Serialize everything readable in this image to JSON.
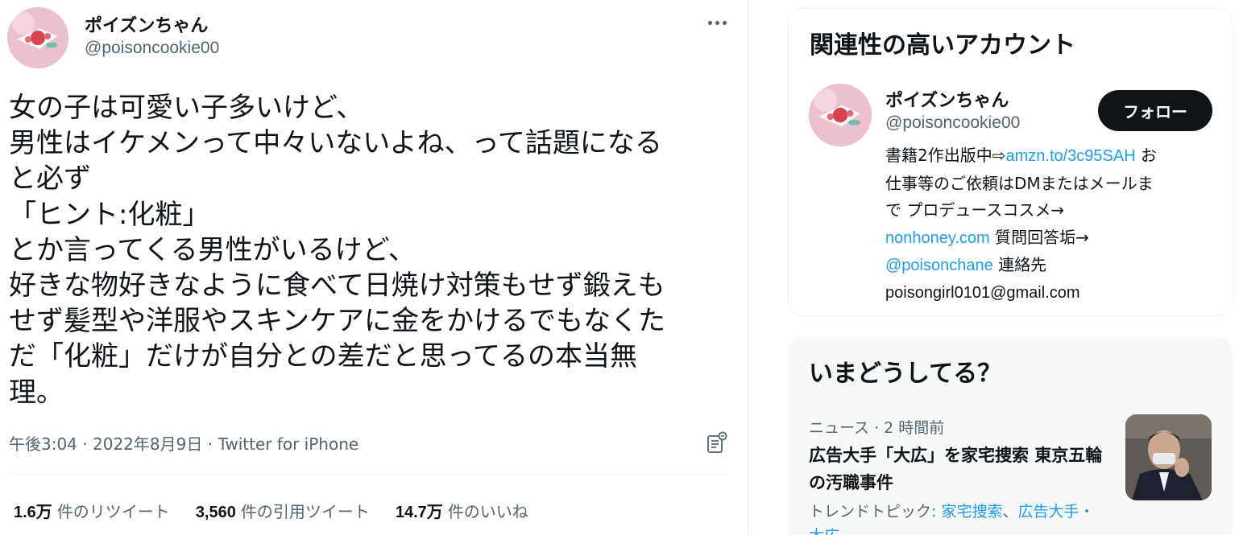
{
  "tweet": {
    "author_name": "ポイズンちゃん",
    "author_handle": "@poisoncookie00",
    "text_lines": [
      "女の子は可愛い子多いけど、",
      "男性はイケメンって中々いないよね、って話題になる",
      "と必ず",
      "「ヒント:化粧」",
      "とか言ってくる男性がいるけど、",
      "好きな物好きなように食べて日焼け対策もせず鍛えも",
      "せず髪型や洋服やスキンケアに金をかけるでもなくた",
      "だ「化粧」だけが自分との差だと思ってるの本当無",
      "理。"
    ],
    "time": "午後3:04",
    "separator": "·",
    "date": "2022年8月9日",
    "source": "Twitter for iPhone",
    "stats": {
      "retweets_count": "1.6万",
      "retweets_label": "件のリツイート",
      "quotes_count": "3,560",
      "quotes_label": "件の引用ツイート",
      "likes_count": "14.7万",
      "likes_label": "件のいいね"
    }
  },
  "sidebar": {
    "related": {
      "title": "関連性の高いアカウント",
      "name": "ポイズンちゃん",
      "handle": "@poisoncookie00",
      "follow_label": "フォロー",
      "bio": {
        "l1_text": "書籍2作出版中⇨",
        "l1_link": "amzn.to/3c95SAH",
        "l1_after": " お",
        "l2": "仕事等のご依頼はDMまたはメールま",
        "l3": "で プロデュースコスメ→",
        "l4_link": "nonhoney.com",
        "l4_after": " 質問回答垢→",
        "l5_link": "@poisonchane",
        "l5_after": " 連絡先",
        "l6": "poisongirl0101@gmail.com"
      }
    },
    "trends": {
      "title": "いまどうしてる？",
      "meta": "ニュース · 2 時間前",
      "headline": "広告大手「大広」を家宅捜索 東京五輪の汚職事件",
      "topics_label": "トレンドトピック: ",
      "topic1": "家宅捜索",
      "topic_sep": "、",
      "topic2": "広告大手",
      "topic_tail": "・大広"
    }
  },
  "colors": {
    "text_primary": "#0f1419",
    "text_secondary": "#536471",
    "link": "#1d9bf0",
    "follow_button": "#0f1419",
    "trends_bg": "#f7f9f9"
  },
  "icons": [
    "more-icon",
    "analytics-icon"
  ]
}
